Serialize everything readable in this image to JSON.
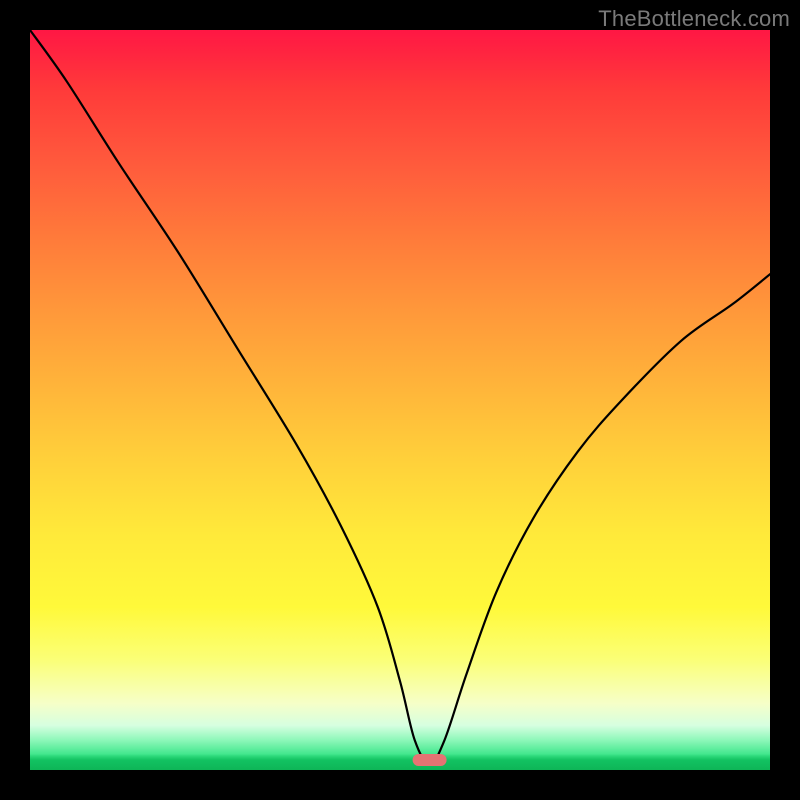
{
  "watermark": "TheBottleneck.com",
  "chart_data": {
    "type": "line",
    "title": "",
    "xlabel": "",
    "ylabel": "",
    "xlim": [
      0,
      100
    ],
    "ylim": [
      0,
      100
    ],
    "x": [
      0,
      5,
      12,
      20,
      28,
      36,
      42,
      47,
      50,
      52,
      54,
      56,
      59,
      63,
      68,
      74,
      80,
      88,
      95,
      100
    ],
    "values": [
      100,
      93,
      82,
      70,
      57,
      44,
      33,
      22,
      12,
      4,
      0,
      4,
      13,
      24,
      34,
      43,
      50,
      58,
      63,
      67
    ],
    "minimum_x": 54,
    "marker": {
      "x": 54,
      "y": 0,
      "color": "#e57373"
    },
    "background_gradient": {
      "top_color": "#ff1744",
      "mid_color": "#ffe93a",
      "bottom_color": "#0eb557"
    }
  }
}
